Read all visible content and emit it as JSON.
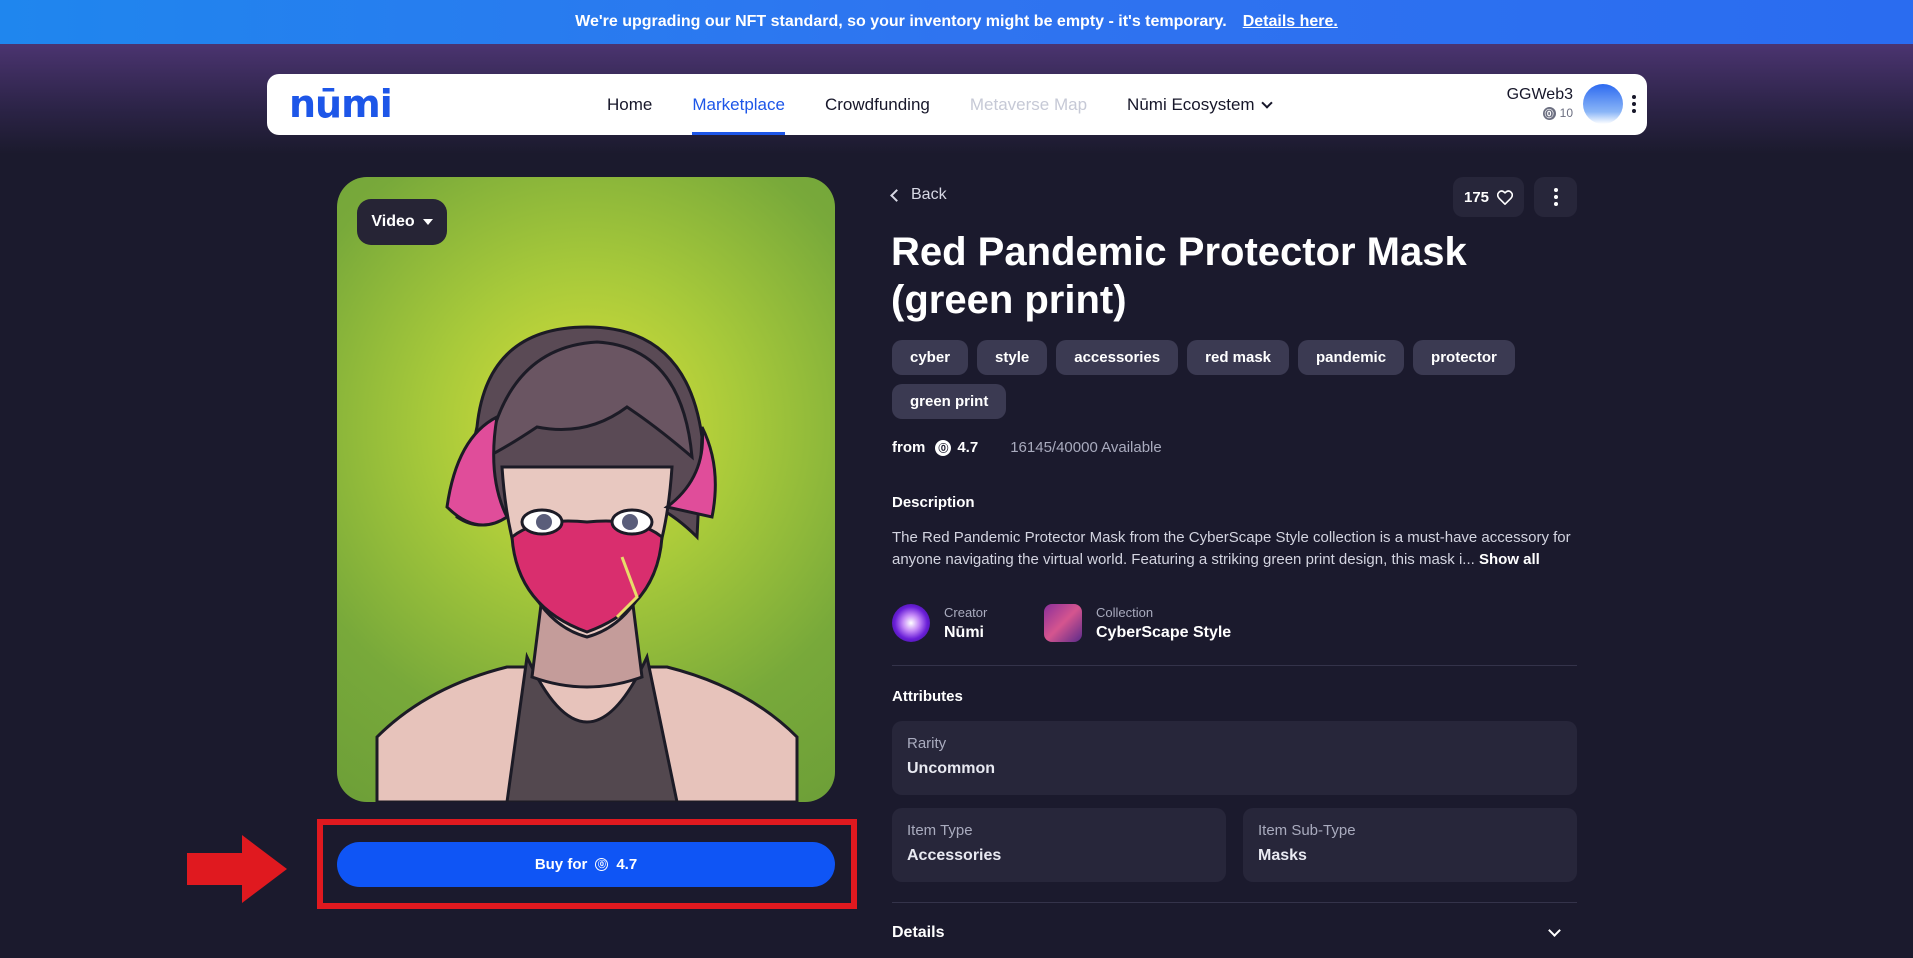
{
  "banner": {
    "message": "We're upgrading our NFT standard, so your inventory might be empty - it's temporary.",
    "link": "Details here."
  },
  "nav": {
    "logo": "nūmi",
    "links": [
      "Home",
      "Marketplace",
      "Crowdfunding",
      "Metaverse Map",
      "Nūmi Ecosystem"
    ],
    "active": "Marketplace",
    "disabled": "Metaverse Map",
    "user": {
      "name": "GGWeb3",
      "balance": "10"
    }
  },
  "media": {
    "mode_label": "Video"
  },
  "buy": {
    "label": "Buy for",
    "price": "4.7"
  },
  "item": {
    "back_label": "Back",
    "likes": "175",
    "title": "Red Pandemic Protector Mask (green print)",
    "tags": [
      "cyber",
      "style",
      "accessories",
      "red mask",
      "pandemic",
      "protector",
      "green print"
    ],
    "from_label": "from",
    "price": "4.7",
    "availability": "16145/40000 Available",
    "description_title": "Description",
    "description": "The Red Pandemic Protector Mask from the CyberScape Style collection is a must-have accessory for anyone navigating the virtual world. Featuring a striking green print design, this mask i...",
    "show_all": "Show all",
    "creator_label": "Creator",
    "creator": "Nūmi",
    "collection_label": "Collection",
    "collection": "CyberScape Style",
    "attributes_title": "Attributes",
    "attributes": [
      {
        "key": "Rarity",
        "value": "Uncommon"
      },
      {
        "key": "Item Type",
        "value": "Accessories"
      },
      {
        "key": "Item Sub-Type",
        "value": "Masks"
      }
    ],
    "details_title": "Details"
  },
  "colors": {
    "accent": "#0f55f5",
    "highlight": "#e0191f",
    "bg": "#1b1a2d",
    "tag": "#3b3a52"
  }
}
